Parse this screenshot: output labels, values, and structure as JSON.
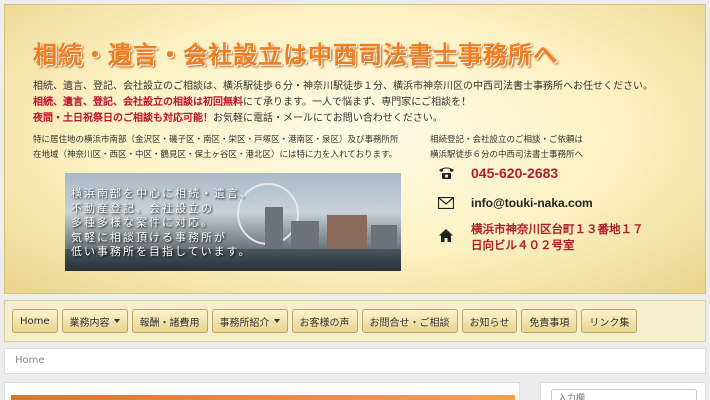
{
  "header": {
    "site_title": "相続・遺言・会社設立は中西司法書士事務所へ",
    "intro_line1": "相続、遺言、登記、会社設立のご相談は、横浜駅徒歩６分・神奈川駅徒歩１分、横浜市神奈川区の中西司法書士事務所へお任せください。",
    "intro_line2_red": "相続、遺言、登記、会社設立の相談は初回無料",
    "intro_line2_rest": "にて承ります。一人で悩まず、専門家にご相談を！",
    "intro_line3_red": "夜間・土日祝祭日のご相談も対応可能！",
    "intro_line3_rest": "お気軽に電話・メールにてお問い合わせください。",
    "area_line1": "特に居住地の横浜市南部（金沢区・磯子区・南区・栄区・戸塚区・港南区・泉区）及び事務所所",
    "area_line2": "在地域（神奈川区・西区・中区・鶴見区・保土ヶ谷区・港北区）には特に力を入れております。",
    "service_line1": "相続登記・会社設立のご相談・ご依頼は",
    "service_line2": "横浜駅徒歩６分の中西司法書士事務所へ",
    "photo_text": [
      "横浜南部を中心に相続・遺言、",
      "不動産登記、会社設立の",
      "多種多様な案件に対応。",
      "気軽に相談頂ける事務所が",
      "低い事務所を目指しています。"
    ],
    "phone": "045-620-2683",
    "email": "info@touki-naka.com",
    "address_line1": "横浜市神奈川区台町１３番地１７",
    "address_line2": "日向ビル４０２号室"
  },
  "nav": {
    "items": [
      {
        "label": "Home",
        "dropdown": false
      },
      {
        "label": "業務内容",
        "dropdown": true
      },
      {
        "label": "報酬・諸費用",
        "dropdown": false
      },
      {
        "label": "事務所紹介",
        "dropdown": true
      },
      {
        "label": "お客様の声",
        "dropdown": false
      },
      {
        "label": "お問合せ・ご相談",
        "dropdown": false
      },
      {
        "label": "お知らせ",
        "dropdown": false
      },
      {
        "label": "免責事項",
        "dropdown": false
      },
      {
        "label": "リンク集",
        "dropdown": false
      }
    ]
  },
  "breadcrumb": {
    "current": "Home"
  },
  "sidebar": {
    "search_placeholder": "入力欄"
  },
  "colors": {
    "accent_orange": "#f07d20",
    "accent_red": "#c0122c",
    "nav_bg": "#f6efcf"
  },
  "icons": {
    "phone": "phone-icon",
    "email": "envelope-icon",
    "address": "home-icon"
  }
}
